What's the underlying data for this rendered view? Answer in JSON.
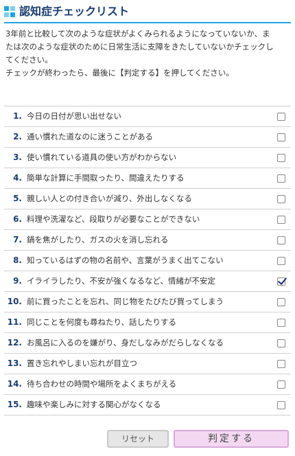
{
  "header": {
    "title": "認知症チェックリスト",
    "icon": "grid-squares-icon",
    "accent_color": "#1fa3e0",
    "title_color": "#1a3d6e"
  },
  "intro": {
    "line1": "3年前と比較して次のような症状がよくみられるようになっていないか、ま",
    "line2": "たは次のような症状のために日常生活に支障をきたしていないかチェックし",
    "line3": "てください。",
    "line4": "チェックが終わったら、最後に【判定する】を押してください。"
  },
  "items": [
    {
      "num": "1.",
      "label": "今日の日付が思い出せない",
      "checked": false
    },
    {
      "num": "2.",
      "label": "通い慣れた道なのに迷うことがある",
      "checked": false
    },
    {
      "num": "3.",
      "label": "使い慣れている道具の使い方がわからない",
      "checked": false
    },
    {
      "num": "4.",
      "label": "簡単な計算に手間取ったり、間違えたりする",
      "checked": false
    },
    {
      "num": "5.",
      "label": "親しい人との付き合いが減り、外出しなくなる",
      "checked": false
    },
    {
      "num": "6.",
      "label": "料理や洗濯など、段取りが必要なことができない",
      "checked": false
    },
    {
      "num": "7.",
      "label": "鍋を焦がしたり、ガスの火を消し忘れる",
      "checked": false
    },
    {
      "num": "8.",
      "label": "知っているはずの物の名前や、言葉がうまく出てこない",
      "checked": false
    },
    {
      "num": "9.",
      "label": "イライラしたり、不安が強くなるなど、情緒が不安定",
      "checked": true
    },
    {
      "num": "10.",
      "label": "前に買ったことを忘れ、同じ物をたびたび買ってしまう",
      "checked": false
    },
    {
      "num": "11.",
      "label": "同じことを何度も尋ねたり、話したりする",
      "checked": false
    },
    {
      "num": "12.",
      "label": "お風呂に入るのを嫌がり、身だしなみがだらしなくなる",
      "checked": false
    },
    {
      "num": "13.",
      "label": "置き忘れやしまい忘れが目立つ",
      "checked": false
    },
    {
      "num": "14.",
      "label": "待ち合わせの時間や場所をよくまちがえる",
      "checked": false
    },
    {
      "num": "15.",
      "label": "趣味や楽しみに対する関心がなくなる",
      "checked": false
    }
  ],
  "buttons": {
    "reset_label": "リセット",
    "judge_label": "判定する",
    "judge_color": "#f4d8f2"
  }
}
